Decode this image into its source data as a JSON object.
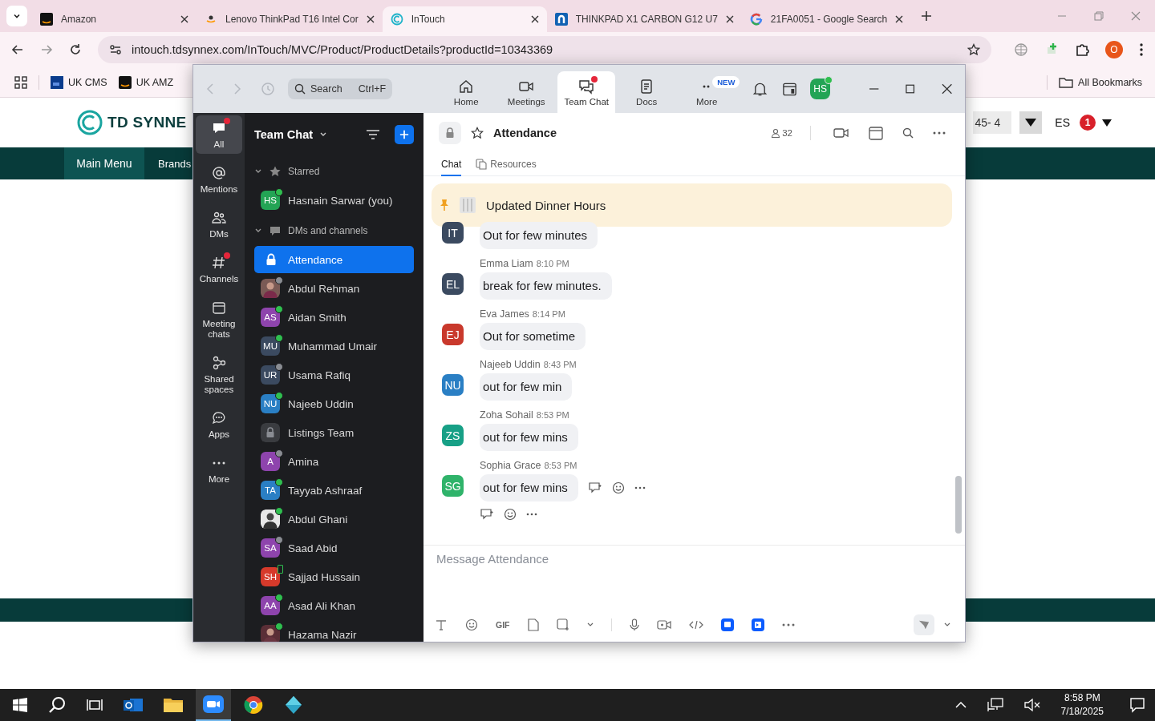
{
  "browser": {
    "tabs": [
      {
        "title": "Amazon",
        "selected": false
      },
      {
        "title": "Lenovo ThinkPad T16 Intel Cor",
        "selected": false
      },
      {
        "title": "InTouch",
        "selected": true
      },
      {
        "title": "THINKPAD X1 CARBON G12 U7",
        "selected": false
      },
      {
        "title": "21FA0051 - Google Search",
        "selected": false
      }
    ],
    "url": "intouch.tdsynnex.com/InTouch/MVC/Product/ProductDetails?productId=10343369",
    "profile": "O",
    "bookmarks": [
      "UK CMS",
      "UK AMZ"
    ],
    "all_bookmarks": "All Bookmarks"
  },
  "page": {
    "logo": "TD SYNNE",
    "nav": [
      {
        "label": "Main Menu",
        "selected": true
      },
      {
        "label": "Brands",
        "selected": false
      }
    ],
    "field_value": "45- 4",
    "language": "ES",
    "badge": "1"
  },
  "app": {
    "search": {
      "placeholder": "Search",
      "shortcut": "Ctrl+F"
    },
    "nav": [
      {
        "label": "Home",
        "selected": false,
        "badge": false
      },
      {
        "label": "Meetings",
        "selected": false,
        "badge": false
      },
      {
        "label": "Team Chat",
        "selected": true,
        "badge": true
      },
      {
        "label": "Docs",
        "selected": false,
        "badge": false
      },
      {
        "label": "More",
        "selected": false,
        "badge": false,
        "tag": "NEW"
      }
    ],
    "user": {
      "initials": "HS",
      "online": true
    },
    "rail": [
      {
        "label": "All",
        "selected": true,
        "badge": true
      },
      {
        "label": "Mentions",
        "selected": false,
        "badge": false
      },
      {
        "label": "DMs",
        "selected": false,
        "badge": false
      },
      {
        "label": "Channels",
        "selected": false,
        "badge": true
      },
      {
        "label": "Meeting chats",
        "selected": false,
        "badge": false
      },
      {
        "label": "Shared spaces",
        "selected": false,
        "badge": false
      },
      {
        "label": "Apps",
        "selected": false,
        "badge": false
      },
      {
        "label": "More",
        "selected": false,
        "badge": false
      }
    ],
    "list": {
      "title": "Team Chat",
      "sections": [
        {
          "label": "Starred",
          "expanded": true,
          "items": [
            {
              "name": "Hasnain Sarwar (you)",
              "kind": "person",
              "initials": "HS",
              "color": "#23a455",
              "online": true,
              "mobile": false,
              "selected": false
            }
          ]
        },
        {
          "label": "DMs and channels",
          "expanded": true,
          "items": [
            {
              "name": "Attendance",
              "kind": "channel",
              "selected": true
            },
            {
              "name": "Abdul Rehman",
              "online": false,
              "mobile": false,
              "selected": false
            },
            {
              "name": "Aidan Smith",
              "kind": "person",
              "initials": "AS",
              "color": "#8e44ad",
              "online": true,
              "mobile": false,
              "selected": false
            },
            {
              "name": "Muhammad Umair",
              "kind": "person",
              "initials": "MU",
              "color": "#3b4a60",
              "online": true,
              "mobile": false,
              "selected": false
            },
            {
              "name": "Usama Rafiq",
              "kind": "person",
              "initials": "UR",
              "color": "#3b4a60",
              "online": false,
              "mobile": false,
              "selected": false
            },
            {
              "name": "Najeeb Uddin",
              "kind": "person",
              "initials": "NU",
              "color": "#2a7fc4",
              "online": true,
              "mobile": false,
              "selected": false
            },
            {
              "name": "Listings Team",
              "kind": "channel",
              "selected": false
            },
            {
              "name": "Amina",
              "kind": "person",
              "initials": "A",
              "color": "#8e44ad",
              "online": false,
              "mobile": false,
              "selected": false
            },
            {
              "name": "Tayyab Ashraaf",
              "kind": "person",
              "initials": "TA",
              "color": "#2a7fc4",
              "online": true,
              "mobile": false,
              "selected": false
            },
            {
              "name": "Abdul Ghani",
              "online": true,
              "mobile": false,
              "selected": false
            },
            {
              "name": "Saad Abid",
              "kind": "person",
              "initials": "SA",
              "color": "#8e44ad",
              "online": false,
              "mobile": false,
              "selected": false
            },
            {
              "name": "Sajjad Hussain",
              "kind": "person",
              "initials": "SH",
              "color": "#d63a2b",
              "online": true,
              "mobile": true,
              "selected": false
            },
            {
              "name": "Asad Ali Khan",
              "kind": "person",
              "initials": "AA",
              "color": "#8e44ad",
              "online": true,
              "mobile": false,
              "selected": false
            },
            {
              "name": "Hazama Nazir",
              "online": true,
              "mobile": false,
              "selected": false
            }
          ]
        }
      ]
    },
    "chat": {
      "title": "Attendance",
      "members": "32",
      "tabs": [
        {
          "label": "Chat",
          "selected": true
        },
        {
          "label": "Resources",
          "selected": false
        }
      ],
      "pinned": "Updated Dinner Hours",
      "messages": [
        {
          "initials": "IT",
          "color": "#3b4a60",
          "text": "Out for few minutes",
          "hovered": false
        },
        {
          "sender": "Emma Liam",
          "time": "8:10 PM",
          "initials": "EL",
          "color": "#3b4a60",
          "text": "break for few minutes.",
          "hovered": false
        },
        {
          "sender": "Eva James",
          "time": "8:14 PM",
          "initials": "EJ",
          "color": "#c9392c",
          "text": "Out for sometime",
          "hovered": false
        },
        {
          "sender": "Najeeb Uddin",
          "time": "8:43 PM",
          "initials": "NU",
          "color": "#2a7fc4",
          "text": "out for few min",
          "hovered": false
        },
        {
          "sender": "Zoha Sohail",
          "time": "8:53 PM",
          "initials": "ZS",
          "color": "#17a086",
          "text": "out for few mins",
          "hovered": false
        },
        {
          "sender": "Sophia Grace",
          "time": "8:53 PM",
          "initials": "SG",
          "color": "#2fb36a",
          "text": "out for few mins",
          "hovered": true
        }
      ],
      "composer": {
        "placeholder": "Message Attendance",
        "gif": "GIF"
      }
    }
  },
  "taskbar": {
    "time": "8:58 PM",
    "date": "7/18/2025"
  }
}
